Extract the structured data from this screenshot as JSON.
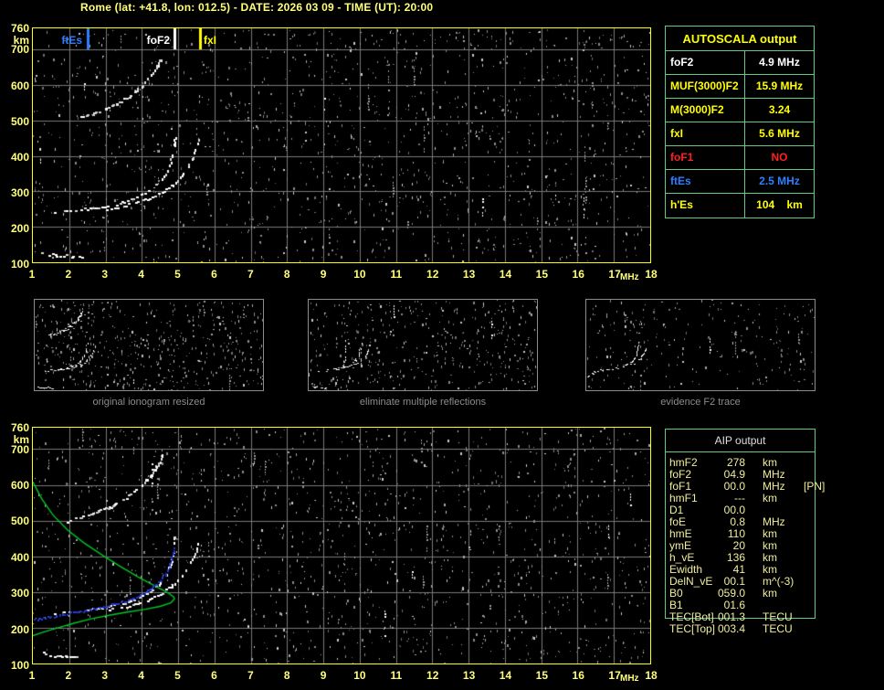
{
  "title": "Rome (lat: +41.8, lon: 012.5) - DATE: 2026 03 09 - TIME (UT): 20:00",
  "colors": {
    "background": "#000000",
    "plot_border": "#FFFF00",
    "axis_text": "#FFFF7A",
    "grid": "#787878",
    "table_border": "#5FCC82",
    "table_header_yellow": "#FFFF00",
    "white": "#FFFFFF",
    "red": "#FF2020",
    "blue": "#2E7FFF",
    "profile_green": "#00C826",
    "restored_blue": "#2636CC",
    "caption_gray": "#8C8C8C",
    "aip_text": "#F0EE9C",
    "aip_header": "#DEDEDE"
  },
  "autoscala_table": {
    "title": "AUTOSCALA output",
    "rows": [
      {
        "label": "foF2",
        "value": "4.9 MHz",
        "color": "#FFFFFF"
      },
      {
        "label": "MUF(3000)F2",
        "value": "15.9 MHz",
        "color": "#FFFF00"
      },
      {
        "label": "M(3000)F2",
        "value": "3.24",
        "color": "#FFFF00"
      },
      {
        "label": "fxI",
        "value": "5.6 MHz",
        "color": "#FFFF00"
      },
      {
        "label": "foF1",
        "value": "NO",
        "color": "#FF2020"
      },
      {
        "label": "ftEs",
        "value": "2.5 MHz",
        "color": "#2E7FFF"
      },
      {
        "label": "h'Es",
        "value": "104    km",
        "color": "#FFFF00"
      }
    ]
  },
  "aip_table": {
    "title": "AIP output",
    "rows": [
      {
        "label": "hmF2",
        "value": "278",
        "unit": "km",
        "extra": ""
      },
      {
        "label": "foF2",
        "value": "04.9",
        "unit": "MHz",
        "extra": ""
      },
      {
        "label": "foF1",
        "value": "00.0",
        "unit": "MHz",
        "extra": "[PN]"
      },
      {
        "label": "hmF1",
        "value": "---",
        "unit": "km",
        "extra": ""
      },
      {
        "label": "D1",
        "value": "00.0",
        "unit": "",
        "extra": ""
      },
      {
        "label": "foE",
        "value": "0.8",
        "unit": "MHz",
        "extra": ""
      },
      {
        "label": "hmE",
        "value": "110",
        "unit": "km",
        "extra": ""
      },
      {
        "label": "ymE",
        "value": "20",
        "unit": "km",
        "extra": ""
      },
      {
        "label": "h_vE",
        "value": "136",
        "unit": "km",
        "extra": ""
      },
      {
        "label": "Ewidth",
        "value": "41",
        "unit": "km",
        "extra": ""
      },
      {
        "label": "DelN_vE",
        "value": "00.1",
        "unit": "m^(-3)",
        "extra": ""
      },
      {
        "label": "B0",
        "value": "059.0",
        "unit": "km",
        "extra": ""
      },
      {
        "label": "B1",
        "value": "01.6",
        "unit": "",
        "extra": ""
      },
      {
        "label": "TEC[Bot]",
        "value": "001.3",
        "unit": "TECU",
        "extra": ""
      },
      {
        "label": "TEC[Top]",
        "value": "003.4",
        "unit": "TECU",
        "extra": ""
      }
    ]
  },
  "units": {
    "x": "MHz",
    "y": "km"
  },
  "trace_points": {
    "e_layer": [
      [
        1.25,
        130
      ],
      [
        1.45,
        124
      ],
      [
        1.65,
        121
      ],
      [
        1.85,
        120
      ],
      [
        2.05,
        119
      ],
      [
        2.25,
        118
      ],
      [
        2.4,
        117
      ]
    ],
    "f2_o": [
      [
        1.6,
        242
      ],
      [
        2.0,
        247
      ],
      [
        2.4,
        251
      ],
      [
        2.8,
        256
      ],
      [
        3.2,
        263
      ],
      [
        3.6,
        274
      ],
      [
        3.9,
        287
      ],
      [
        4.2,
        303
      ],
      [
        4.45,
        323
      ],
      [
        4.65,
        350
      ],
      [
        4.78,
        382
      ],
      [
        4.86,
        415
      ],
      [
        4.9,
        450
      ],
      [
        4.91,
        462
      ]
    ],
    "f2_x": [
      [
        3.0,
        251
      ],
      [
        3.4,
        258
      ],
      [
        3.8,
        268
      ],
      [
        4.2,
        281
      ],
      [
        4.55,
        300
      ],
      [
        4.85,
        322
      ],
      [
        5.1,
        348
      ],
      [
        5.3,
        378
      ],
      [
        5.45,
        410
      ],
      [
        5.55,
        440
      ],
      [
        5.58,
        455
      ]
    ],
    "so_o": [
      [
        1.95,
        500
      ],
      [
        2.3,
        511
      ],
      [
        2.65,
        522
      ],
      [
        3.0,
        535
      ],
      [
        3.35,
        552
      ],
      [
        3.7,
        575
      ],
      [
        4.0,
        602
      ],
      [
        4.25,
        632
      ],
      [
        4.45,
        665
      ],
      [
        4.55,
        692
      ]
    ],
    "so_x": [
      [
        2.5,
        514
      ],
      [
        2.85,
        527
      ],
      [
        3.2,
        543
      ],
      [
        3.55,
        563
      ],
      [
        3.9,
        590
      ],
      [
        4.2,
        622
      ],
      [
        4.45,
        658
      ],
      [
        4.6,
        690
      ]
    ],
    "green_profile": [
      [
        1.0,
        608
      ],
      [
        1.25,
        560
      ],
      [
        1.55,
        516
      ],
      [
        1.95,
        474
      ],
      [
        2.4,
        438
      ],
      [
        2.9,
        404
      ],
      [
        3.4,
        372
      ],
      [
        3.9,
        342
      ],
      [
        4.35,
        318
      ],
      [
        4.7,
        299
      ],
      [
        4.87,
        287
      ],
      [
        4.9,
        281
      ],
      [
        4.8,
        270
      ],
      [
        4.5,
        260
      ],
      [
        4.1,
        252
      ],
      [
        3.6,
        244
      ],
      [
        3.1,
        235
      ],
      [
        2.6,
        225
      ],
      [
        2.1,
        212
      ],
      [
        1.7,
        200
      ],
      [
        1.35,
        190
      ],
      [
        1.0,
        178
      ]
    ],
    "blue_restored": [
      [
        1.05,
        222
      ],
      [
        1.4,
        230
      ],
      [
        1.8,
        238
      ],
      [
        2.2,
        246
      ],
      [
        2.6,
        253
      ],
      [
        3.0,
        262
      ],
      [
        3.4,
        272
      ],
      [
        3.75,
        284
      ],
      [
        4.05,
        298
      ],
      [
        4.3,
        315
      ],
      [
        4.5,
        335
      ],
      [
        4.68,
        360
      ],
      [
        4.8,
        390
      ],
      [
        4.87,
        415
      ],
      [
        4.9,
        432
      ]
    ],
    "evidence_lead": [
      [
        1.05,
        208
      ],
      [
        1.35,
        224
      ],
      [
        1.65,
        234
      ],
      [
        1.95,
        243
      ]
    ],
    "f2_x_part": [
      [
        4.3,
        285
      ],
      [
        4.65,
        305
      ],
      [
        4.95,
        330
      ],
      [
        5.2,
        358
      ],
      [
        5.4,
        392
      ],
      [
        5.5,
        425
      ]
    ]
  },
  "chart_data": [
    {
      "id": "top_ionogram",
      "type": "scatter",
      "title": "recorded ionogram with scaled characteristics",
      "xlabel": "MHz",
      "ylabel": "km",
      "xlim": [
        1,
        18
      ],
      "ylim": [
        100,
        760
      ],
      "xticks": [
        1,
        2,
        3,
        4,
        5,
        6,
        7,
        8,
        9,
        10,
        11,
        12,
        13,
        14,
        15,
        16,
        17,
        18
      ],
      "yticks": [
        760,
        700,
        600,
        500,
        400,
        300,
        200,
        100
      ],
      "grid": true,
      "markers": [
        {
          "label": "ftEs",
          "freq": 2.5,
          "color": "#2E7FFF",
          "align": "left"
        },
        {
          "label": "foF2",
          "freq": 4.9,
          "color": "#FFFFFF",
          "align": "left"
        },
        {
          "label": "fxI",
          "freq": 5.6,
          "color": "#FFFF00",
          "align": "right"
        }
      ],
      "traces": [
        {
          "ref": "e_layer",
          "kind": "dash"
        },
        {
          "ref": "f2_o",
          "kind": "dash"
        },
        {
          "ref": "f2_x",
          "kind": "dash"
        },
        {
          "ref": "so_o",
          "kind": "dash_dim"
        },
        {
          "ref": "so_x",
          "kind": "dash_dim"
        }
      ],
      "noise": {
        "seed": 987241,
        "count": 1500,
        "streaks": 26
      }
    },
    {
      "id": "bottom_ionogram",
      "type": "scatter",
      "title": "ionogram with restored trace and electron density profile",
      "xlabel": "MHz",
      "ylabel": "km",
      "xlim": [
        1,
        18
      ],
      "ylim": [
        100,
        760
      ],
      "xticks": [
        1,
        2,
        3,
        4,
        5,
        6,
        7,
        8,
        9,
        10,
        11,
        12,
        13,
        14,
        15,
        16,
        17,
        18
      ],
      "yticks": [
        760,
        700,
        600,
        500,
        400,
        300,
        200,
        100
      ],
      "grid": true,
      "markers": [],
      "traces": [
        {
          "ref": "e_layer",
          "kind": "dash"
        },
        {
          "ref": "f2_o",
          "kind": "dash"
        },
        {
          "ref": "f2_x",
          "kind": "dash"
        },
        {
          "ref": "so_o",
          "kind": "dash_dim"
        },
        {
          "ref": "so_x",
          "kind": "dash_dim"
        },
        {
          "ref": "green_profile",
          "kind": "line",
          "color": "#00C826"
        },
        {
          "ref": "blue_restored",
          "kind": "dots"
        }
      ],
      "noise": {
        "seed": 442113,
        "count": 1500,
        "streaks": 24
      }
    },
    {
      "id": "panel_original",
      "type": "scatter",
      "caption": "original ionogram resized",
      "xlim": [
        1,
        18
      ],
      "ylim": [
        100,
        760
      ],
      "grid": false,
      "small": true,
      "traces": [
        {
          "ref": "e_layer",
          "kind": "dash"
        },
        {
          "ref": "f2_o",
          "kind": "dash"
        },
        {
          "ref": "f2_x",
          "kind": "dash"
        },
        {
          "ref": "so_o",
          "kind": "dash"
        },
        {
          "ref": "so_x",
          "kind": "dash"
        }
      ],
      "noise": {
        "seed": 77001,
        "count": 520,
        "streaks": 7
      }
    },
    {
      "id": "panel_no_multiples",
      "type": "scatter",
      "caption": "eliminate multiple reflections",
      "xlim": [
        1,
        18
      ],
      "ylim": [
        100,
        760
      ],
      "grid": false,
      "small": true,
      "traces": [
        {
          "ref": "e_layer",
          "kind": "dash"
        },
        {
          "ref": "f2_o",
          "kind": "dash"
        },
        {
          "ref": "f2_x",
          "kind": "dash"
        }
      ],
      "noise": {
        "seed": 88002,
        "count": 430,
        "streaks": 5
      }
    },
    {
      "id": "panel_f2_trace",
      "type": "scatter",
      "caption": "evidence F2 trace",
      "xlim": [
        1,
        18
      ],
      "ylim": [
        100,
        760
      ],
      "grid": false,
      "small": true,
      "traces": [
        {
          "ref": "evidence_lead",
          "kind": "dash"
        },
        {
          "ref": "f2_o",
          "kind": "dash"
        },
        {
          "ref": "f2_x_part",
          "kind": "dash"
        }
      ],
      "noise": {
        "seed": 99003,
        "count": 250,
        "streaks": 3
      }
    }
  ]
}
